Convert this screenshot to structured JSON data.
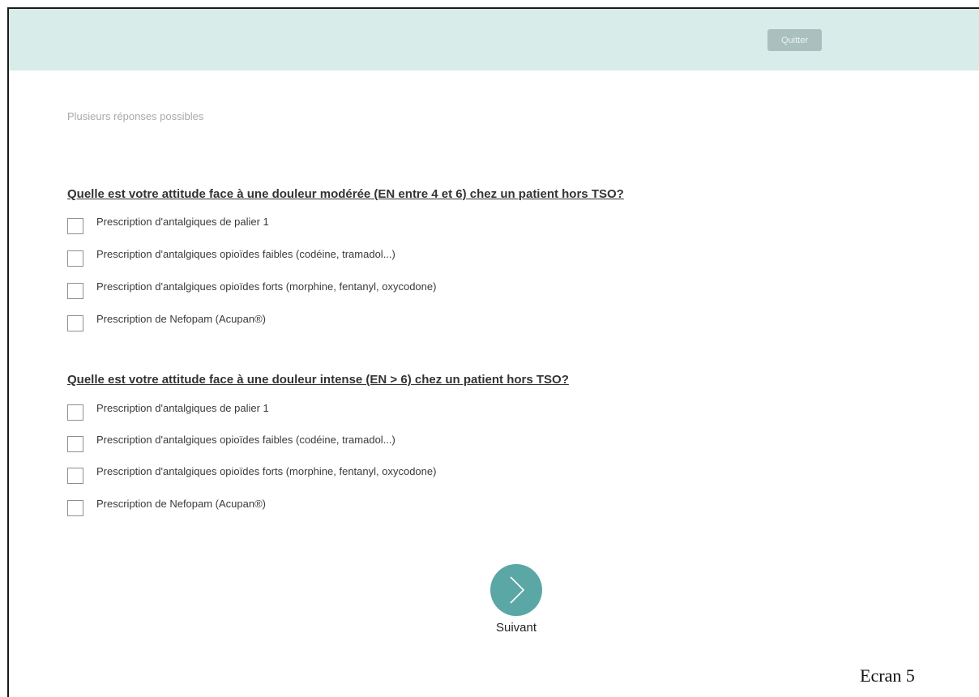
{
  "header": {
    "quit_label": "Quitter",
    "colors": {
      "background": "#d8ecea",
      "button": "#a9c0bf"
    }
  },
  "hint": "Plusieurs réponses possibles",
  "questions": [
    {
      "title": "Quelle est votre attitude face à une douleur modérée (EN entre 4 et 6) chez un patient hors TSO?",
      "options": [
        {
          "label": "Prescription d'antalgiques de palier 1",
          "checked": false
        },
        {
          "label": "Prescription d'antalgiques opioïdes faibles (codéine, tramadol...)",
          "checked": false
        },
        {
          "label": "Prescription d'antalgiques opioïdes forts (morphine, fentanyl, oxycodone)",
          "checked": false
        },
        {
          "label": "Prescription de Nefopam (Acupan®)",
          "checked": false
        }
      ]
    },
    {
      "title": "Quelle est votre attitude face à une douleur intense (EN > 6) chez un patient hors TSO?",
      "options": [
        {
          "label": "Prescription d'antalgiques de palier 1",
          "checked": false
        },
        {
          "label": "Prescription d'antalgiques opioïdes faibles (codéine, tramadol...)",
          "checked": false
        },
        {
          "label": "Prescription d'antalgiques opioïdes forts (morphine, fentanyl, oxycodone)",
          "checked": false
        },
        {
          "label": "Prescription de Nefopam (Acupan®)",
          "checked": false
        }
      ]
    }
  ],
  "next": {
    "label": "Suivant",
    "icon": "chevron-right-icon",
    "color": "#5ba7a5"
  },
  "screen_tag": "Ecran 5"
}
